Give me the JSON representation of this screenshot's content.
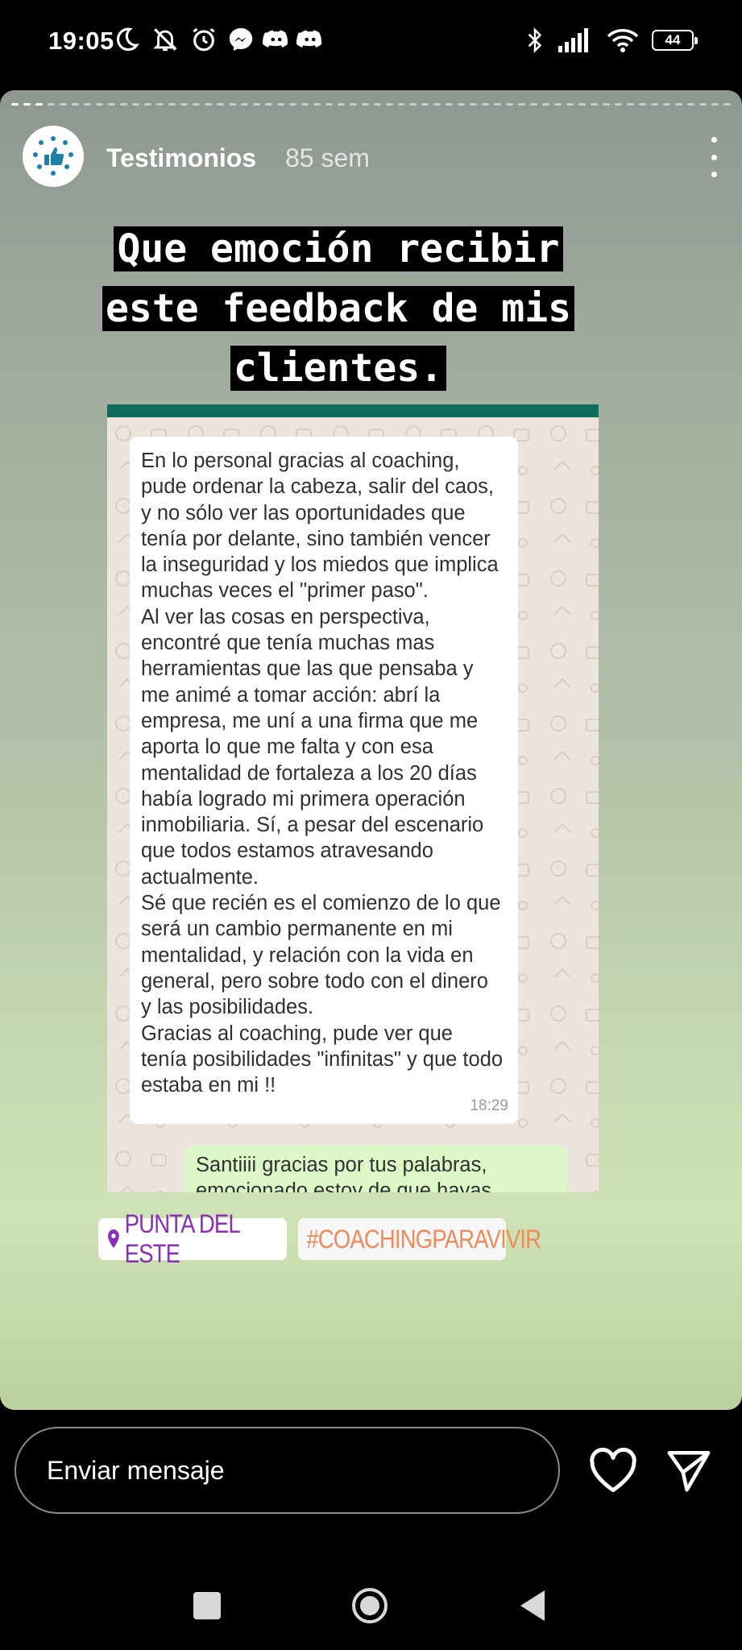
{
  "status_bar": {
    "time": "19:05",
    "icons_left": [
      "moon-icon",
      "notifications-off-icon",
      "alarm-icon",
      "messenger-icon",
      "discord-icon",
      "discord-icon"
    ],
    "icons_right": [
      "bluetooth-icon",
      "signal-icon",
      "wifi-icon"
    ],
    "battery": "44"
  },
  "story": {
    "account_name": "Testimonios",
    "age": "85 sem",
    "avatar_icon": "thumbs-up-stars-icon",
    "progress_segments_total": 60,
    "progress_segments_done": 3,
    "caption_lines": [
      "Que emoción recibir",
      "este feedback de mis",
      "clientes."
    ],
    "chat": {
      "incoming_paragraphs": [
        "En lo personal gracias al coaching, pude ordenar la cabeza, salir del caos, y no sólo ver las oportunidades que tenía por delante, sino también vencer la inseguridad y los miedos que implica muchas veces el \"primer paso\".",
        "Al ver las cosas en perspectiva, encontré que tenía muchas mas herramientas que las que pensaba y me animé a tomar acción: abrí la empresa, me uní a una firma que me aporta lo que me falta y con esa mentalidad de fortaleza a los 20 días había logrado mi primera operación inmobiliaria. Sí, a pesar del escenario que todos estamos atravesando actualmente.",
        "Sé que recién es el comienzo de lo que será un cambio permanente en mi mentalidad, y relación con la vida en general, pero sobre todo con el dinero y las posibilidades.",
        "Gracias al coaching, pude ver que tenía posibilidades \"infinitas\" y que todo estaba en mi !!"
      ],
      "incoming_time": "18:29",
      "outgoing_text": "Santiiii gracias por tus palabras, emocionado estoy de que hayas"
    },
    "location_sticker": "PUNTA DEL ESTE",
    "hashtag_sticker": "#COACHINGPARAVIVIR"
  },
  "reply": {
    "placeholder": "Enviar mensaje",
    "like_icon": "heart-icon",
    "send_icon": "send-icon"
  },
  "colors": {
    "chat_header": "#0f6b5b",
    "outgoing_bubble": "#dcf8c6",
    "location_sticker": "#8a2fb8",
    "hashtag_sticker": "#f08a5b"
  }
}
